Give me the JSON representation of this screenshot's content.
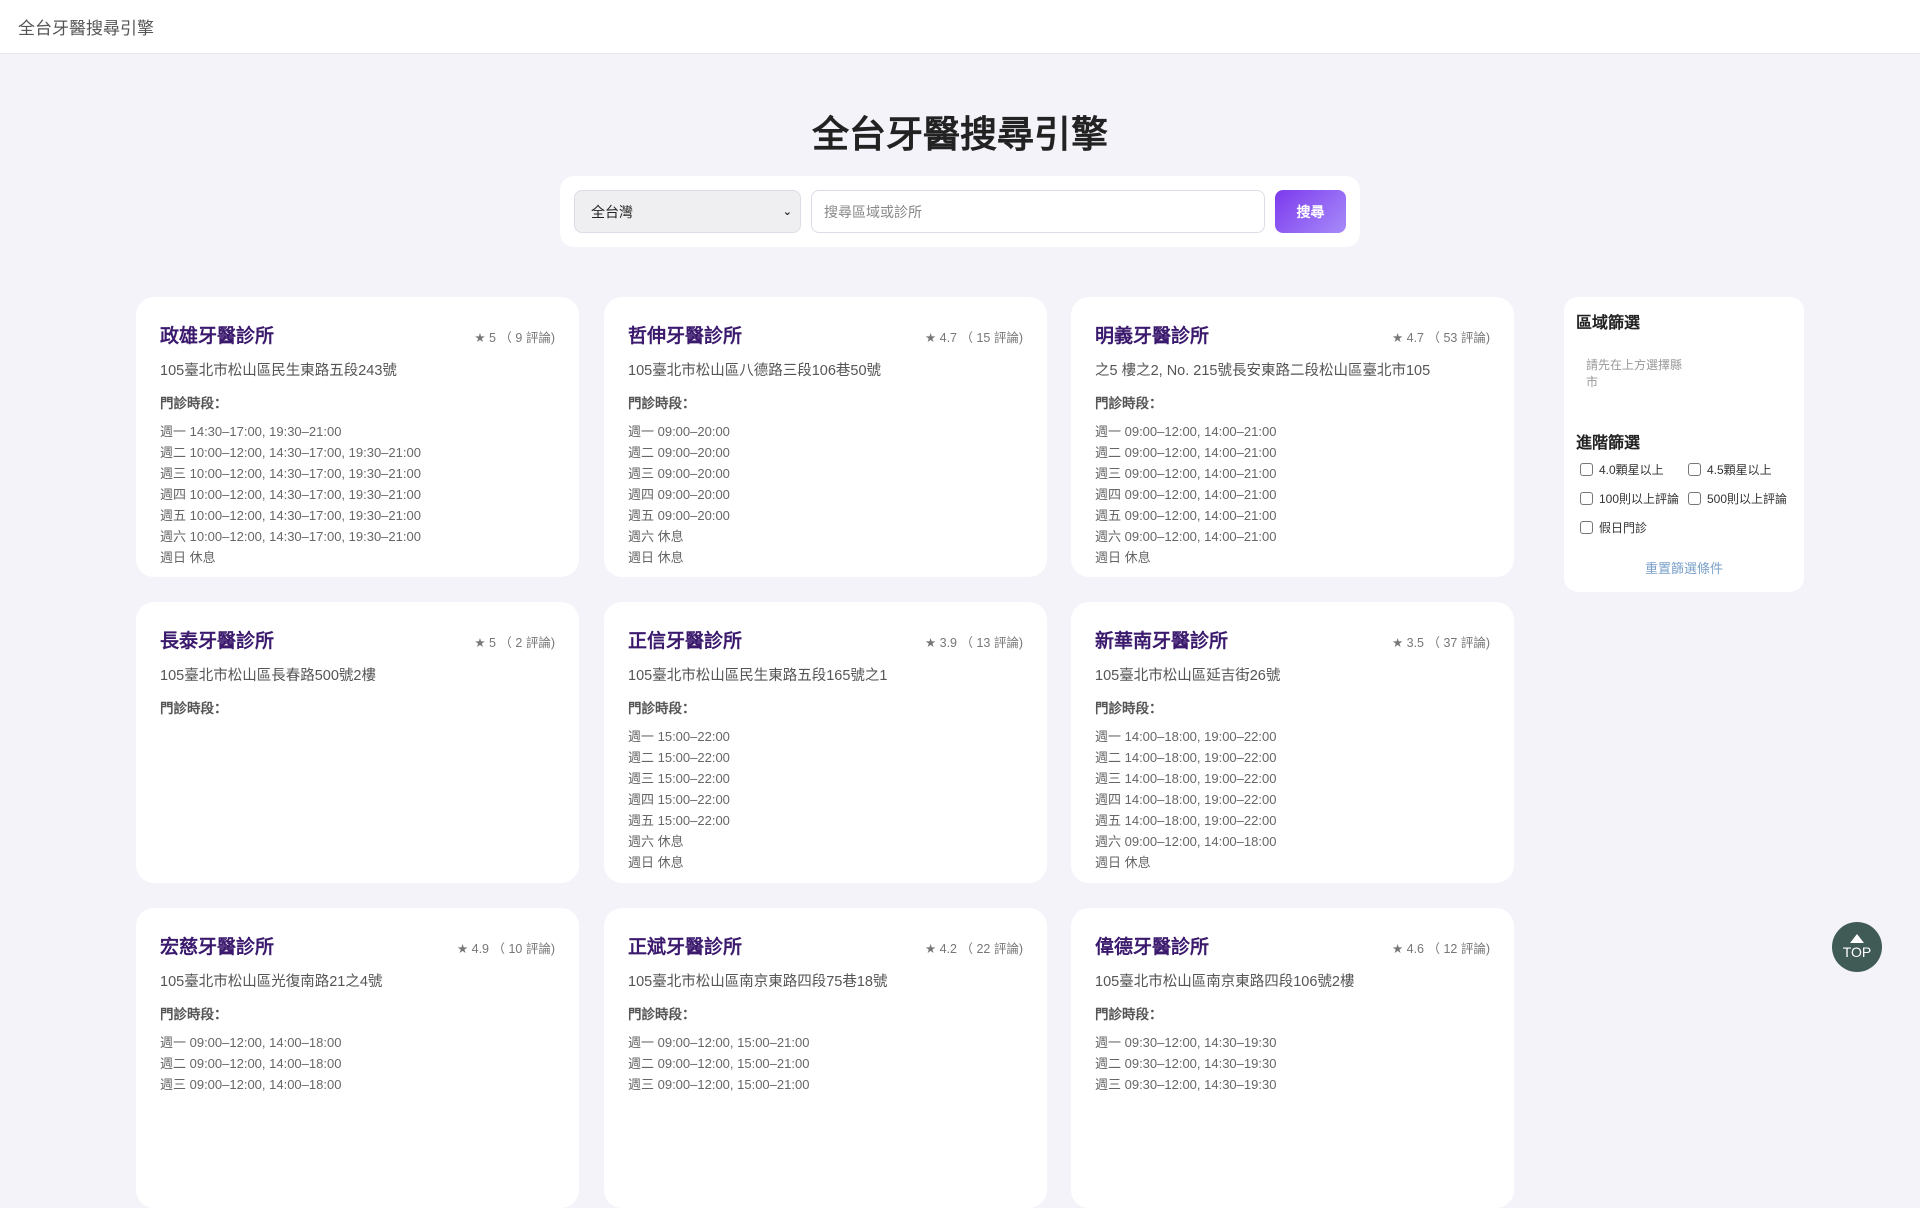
{
  "header": {
    "title": "全台牙醫搜尋引擎"
  },
  "main": {
    "title": "全台牙醫搜尋引擎"
  },
  "search": {
    "region": "全台灣",
    "placeholder": "搜尋區域或診所",
    "button": "搜尋"
  },
  "hours_label": "門診時段：",
  "clinics": [
    {
      "name": "政雄牙醫診所",
      "rating": "★ 5 （ 9 評論)",
      "address": "105臺北市松山區民生東路五段243號",
      "hours": [
        "週一 14:30–17:00, 19:30–21:00",
        "週二 10:00–12:00, 14:30–17:00, 19:30–21:00",
        "週三 10:00–12:00, 14:30–17:00, 19:30–21:00",
        "週四 10:00–12:00, 14:30–17:00, 19:30–21:00",
        "週五 10:00–12:00, 14:30–17:00, 19:30–21:00",
        "週六 10:00–12:00, 14:30–17:00, 19:30–21:00",
        "週日 休息"
      ]
    },
    {
      "name": "哲伸牙醫診所",
      "rating": "★ 4.7 （ 15 評論)",
      "address": "105臺北市松山區八德路三段106巷50號",
      "hours": [
        "週一 09:00–20:00",
        "週二 09:00–20:00",
        "週三 09:00–20:00",
        "週四 09:00–20:00",
        "週五 09:00–20:00",
        "週六 休息",
        "週日 休息"
      ]
    },
    {
      "name": "明義牙醫診所",
      "rating": "★ 4.7 （ 53 評論)",
      "address": "之5 樓之2, No. 215號長安東路二段松山區臺北市105",
      "hours": [
        "週一 09:00–12:00, 14:00–21:00",
        "週二 09:00–12:00, 14:00–21:00",
        "週三 09:00–12:00, 14:00–21:00",
        "週四 09:00–12:00, 14:00–21:00",
        "週五 09:00–12:00, 14:00–21:00",
        "週六 09:00–12:00, 14:00–21:00",
        "週日 休息"
      ]
    },
    {
      "name": "長泰牙醫診所",
      "rating": "★ 5 （ 2 評論)",
      "address": "105臺北市松山區長春路500號2樓",
      "hours": []
    },
    {
      "name": "正信牙醫診所",
      "rating": "★ 3.9 （ 13 評論)",
      "address": "105臺北市松山區民生東路五段165號之1",
      "hours": [
        "週一 15:00–22:00",
        "週二 15:00–22:00",
        "週三 15:00–22:00",
        "週四 15:00–22:00",
        "週五 15:00–22:00",
        "週六 休息",
        "週日 休息"
      ]
    },
    {
      "name": "新華南牙醫診所",
      "rating": "★ 3.5 （ 37 評論)",
      "address": "105臺北市松山區延吉街26號",
      "hours": [
        "週一 14:00–18:00, 19:00–22:00",
        "週二 14:00–18:00, 19:00–22:00",
        "週三 14:00–18:00, 19:00–22:00",
        "週四 14:00–18:00, 19:00–22:00",
        "週五 14:00–18:00, 19:00–22:00",
        "週六 09:00–12:00, 14:00–18:00",
        "週日 休息"
      ]
    },
    {
      "name": "宏慈牙醫診所",
      "rating": "★ 4.9 （ 10 評論)",
      "address": "105臺北市松山區光復南路21之4號",
      "hours": [
        "週一 09:00–12:00, 14:00–18:00",
        "週二 09:00–12:00, 14:00–18:00",
        "週三 09:00–12:00, 14:00–18:00"
      ]
    },
    {
      "name": "正斌牙醫診所",
      "rating": "★ 4.2 （ 22 評論)",
      "address": "105臺北市松山區南京東路四段75巷18號",
      "hours": [
        "週一 09:00–12:00, 15:00–21:00",
        "週二 09:00–12:00, 15:00–21:00",
        "週三 09:00–12:00, 15:00–21:00"
      ]
    },
    {
      "name": "偉德牙醫診所",
      "rating": "★ 4.6 （ 12 評論)",
      "address": "105臺北市松山區南京東路四段106號2樓",
      "hours": [
        "週一 09:30–12:00, 14:30–19:30",
        "週二 09:30–12:00, 14:30–19:30",
        "週三 09:30–12:00, 14:30–19:30"
      ]
    }
  ],
  "sidebar": {
    "region_title": "區域篩選",
    "region_hint": "請先在上方選擇縣市",
    "advanced_title": "進階篩選",
    "filters": [
      "4.0顆星以上",
      "4.5顆星以上",
      "100則以上評論",
      "500則以上評論",
      "假日門診"
    ],
    "reset": "重置篩選條件"
  },
  "top_button": "TOP"
}
